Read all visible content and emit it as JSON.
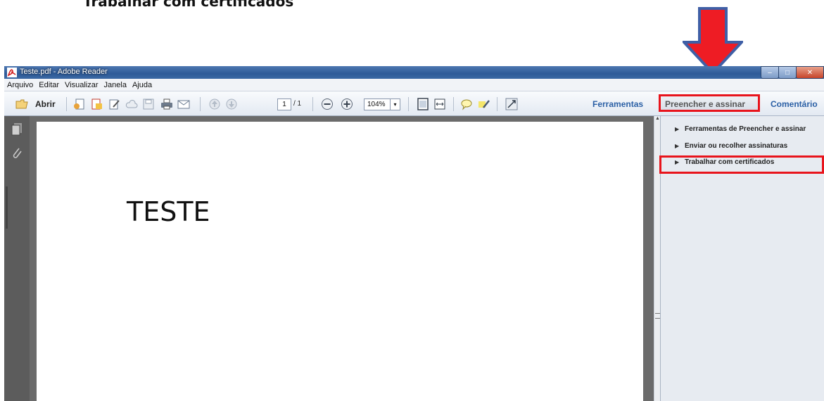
{
  "caption": "Trabalhar com certificados",
  "arrow": {
    "icon": "red-down-arrow-icon",
    "color": "#ee1c24",
    "outline": "#3f5fa6"
  },
  "window": {
    "title": "Teste.pdf - Adobe Reader",
    "controls": {
      "minimize": "–",
      "maximize": "□",
      "close": "✕"
    }
  },
  "menu": [
    "Arquivo",
    "Editar",
    "Visualizar",
    "Janela",
    "Ajuda"
  ],
  "toolbar": {
    "open_label": "Abrir",
    "page_current": "1",
    "page_total": "/ 1",
    "zoom": "104%",
    "zoom_dropdown": "▾",
    "tabs": {
      "tools": "Ferramentas",
      "fill_sign": "Preencher e assinar",
      "comment": "Comentário"
    }
  },
  "document": {
    "text": "TESTE"
  },
  "scrollbar": {
    "up": "▲"
  },
  "panel": {
    "items": [
      {
        "label": "Ferramentas de Preencher e assinar",
        "marker": "▶",
        "highlighted": false
      },
      {
        "label": "Enviar ou recolher assinaturas",
        "marker": "▶",
        "highlighted": false
      },
      {
        "label": "Trabalhar com certificados",
        "marker": "▶",
        "highlighted": true
      }
    ]
  },
  "colors": {
    "highlight": "#e8141c",
    "link_blue": "#2a5fa5",
    "titlebar": "#2e5b98"
  }
}
